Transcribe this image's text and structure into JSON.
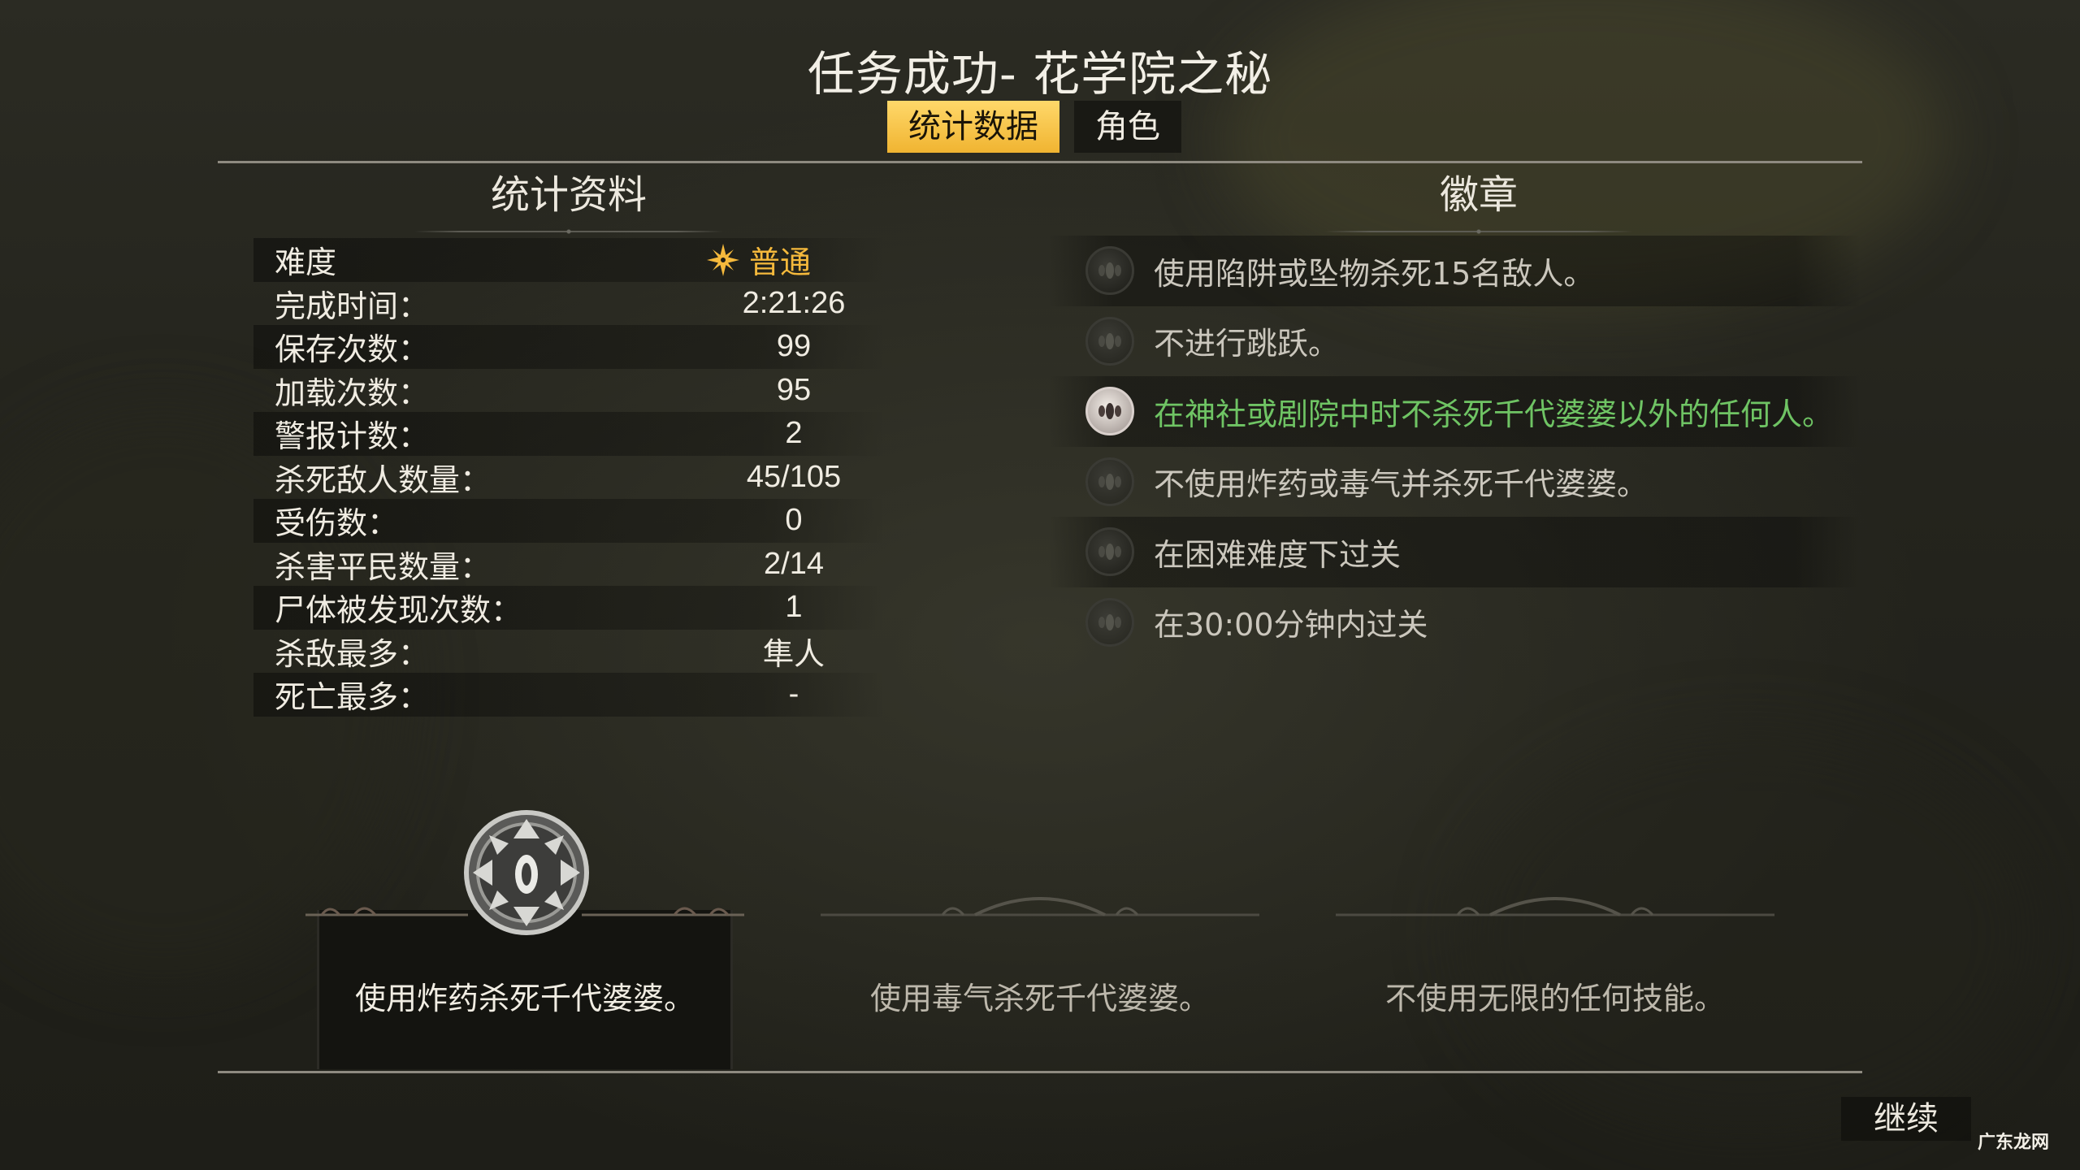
{
  "title": "任务成功- 花学院之秘",
  "tabs": [
    {
      "label": "统计数据",
      "active": true
    },
    {
      "label": "角色",
      "active": false
    }
  ],
  "stats": {
    "heading": "统计资料",
    "difficulty_label": "难度",
    "difficulty_value": "普通",
    "rows": [
      {
        "label": "完成时间：",
        "value": "2:21:26"
      },
      {
        "label": "保存次数：",
        "value": "99"
      },
      {
        "label": "加载次数：",
        "value": "95"
      },
      {
        "label": "警报计数：",
        "value": "2"
      },
      {
        "label": "杀死敌人数量：",
        "value": "45/105"
      },
      {
        "label": "受伤数：",
        "value": "0"
      },
      {
        "label": "杀害平民数量：",
        "value": "2/14"
      },
      {
        "label": "尸体被发现次数：",
        "value": "1"
      },
      {
        "label": "杀敌最多：",
        "value": "隼人"
      },
      {
        "label": "死亡最多：",
        "value": "-"
      }
    ]
  },
  "badges": {
    "heading": "徽章",
    "items": [
      {
        "text": "使用陷阱或坠物杀死15名敌人。",
        "earned": false
      },
      {
        "text": "不进行跳跃。",
        "earned": false
      },
      {
        "text": "在神社或剧院中时不杀死千代婆婆以外的任何人。",
        "earned": true
      },
      {
        "text": "不使用炸药或毒气并杀死千代婆婆。",
        "earned": false
      },
      {
        "text": "在困难难度下过关",
        "earned": false
      },
      {
        "text": "在30:00分钟内过关",
        "earned": false
      }
    ]
  },
  "challenges": [
    {
      "text": "使用炸药杀死千代婆婆。",
      "active": true
    },
    {
      "text": "使用毒气杀死千代婆婆。",
      "active": false
    },
    {
      "text": "不使用无限的任何技能。",
      "active": false
    }
  ],
  "continue_label": "继续",
  "watermark": "广东龙网",
  "colors": {
    "accent": "#f0b431",
    "earned": "#6fc464"
  }
}
